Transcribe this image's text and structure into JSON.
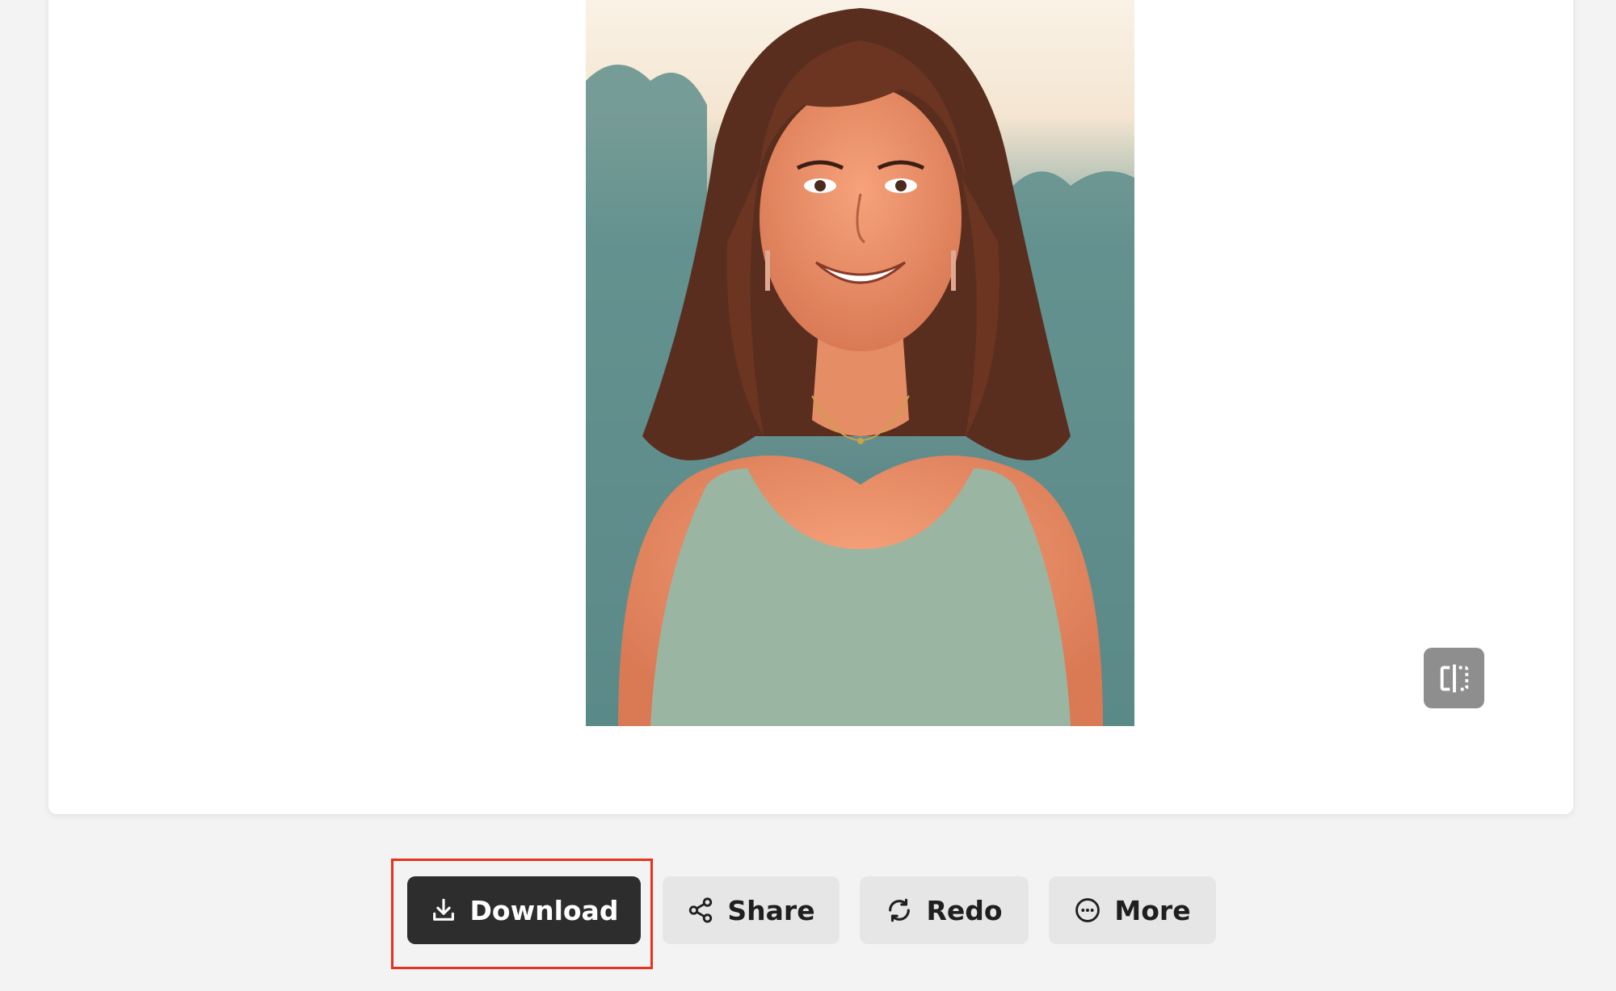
{
  "actions": {
    "download_label": "Download",
    "share_label": "Share",
    "redo_label": "Redo",
    "more_label": "More"
  },
  "icons": {
    "download": "download-icon",
    "share": "share-icon",
    "redo": "redo-icon",
    "more": "more-icon",
    "compare": "compare-split-icon"
  },
  "colors": {
    "primary_button": "#2d2d2d",
    "secondary_button": "#e6e6e6",
    "highlight": "#e8321f",
    "page_background": "#f3f3f3",
    "compare_toggle": "#8e8e8e"
  }
}
